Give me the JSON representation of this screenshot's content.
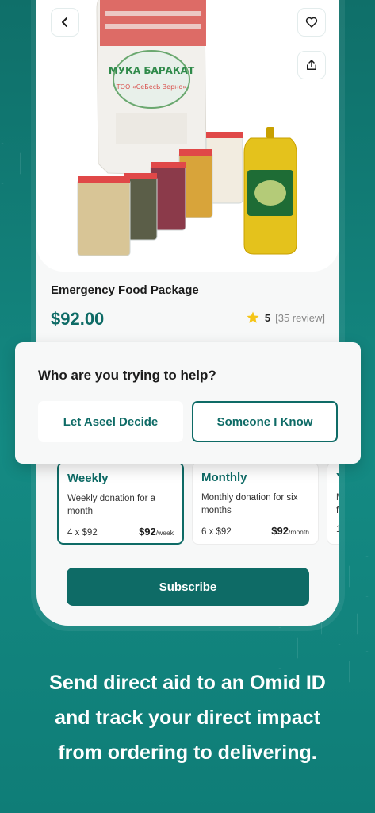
{
  "product": {
    "name": "Emergency Food Package",
    "price": "$92.00",
    "rating": "5",
    "reviews": "[35 review]",
    "bag_brand": "МУКА БАРАКАТ",
    "bag_maker": "ТОО «СеБесЬ Зерно»"
  },
  "popup": {
    "question": "Who are you trying to help?",
    "option_a": "Let Aseel Decide",
    "option_b": "Someone I Know"
  },
  "plans": [
    {
      "title": "Weekly",
      "desc": "Weekly donation for a month",
      "count": "4 x $92",
      "amount": "$92",
      "per": "/week"
    },
    {
      "title": "Monthly",
      "desc": "Monthly donation for six months",
      "count": "6 x $92",
      "amount": "$92",
      "per": "/month"
    },
    {
      "title": "Y",
      "desc": "M\nf",
      "count": "1",
      "amount": "",
      "per": ""
    }
  ],
  "subscribe_label": "Subscribe",
  "caption": {
    "line1": "Send direct aid to an Omid ID",
    "line2": "and track your direct impact",
    "line3": "from ordering to delivering."
  },
  "colors": {
    "brand": "#0e6b66",
    "background": "#137f78",
    "star": "#f5c518"
  },
  "icons": {
    "back": "chevron-left-icon",
    "favorite": "heart-icon",
    "share": "share-icon",
    "rating": "star-icon"
  }
}
